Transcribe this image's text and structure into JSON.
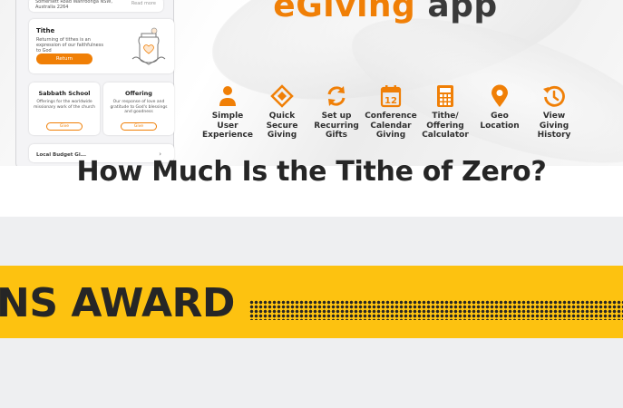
{
  "banner": {
    "app_title_brand": "eGiving",
    "app_title_rest": "app",
    "phone": {
      "top_card": {
        "address": "Somersett Road Wahroonga NSW, Australia 2264",
        "read_more": "Read more"
      },
      "tithe_card": {
        "title": "Tithe",
        "description": "Returning of tithes is an expression of our faithfulness to God",
        "button": "Return"
      },
      "sabbath_card": {
        "title": "Sabbath School",
        "description": "Offerings for the worldwide missionary work of the church",
        "button": "Give"
      },
      "offering_card": {
        "title": "Offering",
        "description": "Our response of love and gratitude to God's blessings and goodness",
        "button": "Give"
      },
      "bottom_card": {
        "title": "Local Budget Gi...",
        "chevron": "›"
      }
    },
    "features": [
      {
        "icon": "user-icon",
        "label_lines": [
          "Simple",
          "User",
          "Experience"
        ]
      },
      {
        "icon": "diamond-icon",
        "label_lines": [
          "Quick",
          "Secure",
          "Giving"
        ]
      },
      {
        "icon": "recurring-icon",
        "label_lines": [
          "Set up",
          "Recurring",
          "Gifts"
        ]
      },
      {
        "icon": "calendar-icon",
        "calendar_day": "12",
        "label_lines": [
          "Conference",
          "Calendar",
          "Giving"
        ]
      },
      {
        "icon": "calculator-icon",
        "label_lines": [
          "Tithe/",
          "Offering",
          "Calculator"
        ]
      },
      {
        "icon": "location-pin-icon",
        "label_lines": [
          "Geo",
          "Location"
        ]
      },
      {
        "icon": "history-icon",
        "label_lines": [
          "View",
          "Giving",
          "History"
        ]
      }
    ]
  },
  "award": {
    "text": "NS AWARD"
  },
  "article": {
    "headline": "How Much Is the Tithe of Zero?"
  },
  "colors": {
    "accent": "#f07f06",
    "award_band": "#fdc210",
    "text_dark": "#262626",
    "section_bg": "#eeeff1"
  }
}
